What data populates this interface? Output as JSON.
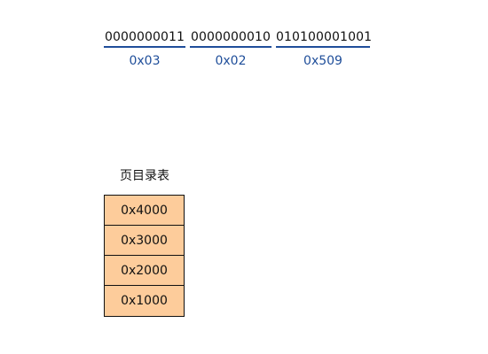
{
  "address_segments": [
    {
      "bits": "0000000011",
      "hex": "0x03"
    },
    {
      "bits": "0000000010",
      "hex": "0x02"
    },
    {
      "bits": "010100001001",
      "hex": "0x509"
    }
  ],
  "page_directory": {
    "title": "页目录表",
    "entries": [
      "0x4000",
      "0x3000",
      "0x2000",
      "0x1000"
    ]
  },
  "colors": {
    "underline": "#1f4e9a",
    "hex_text": "#1f4e9a",
    "cell_fill": "#fdcc9b"
  }
}
